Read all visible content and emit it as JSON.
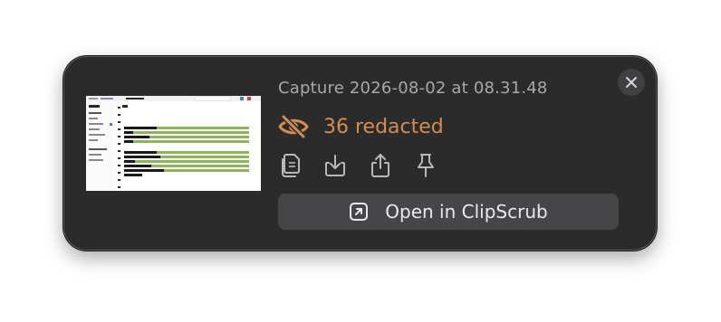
{
  "capture": {
    "title": "Capture 2026-08-02 at 08.31.48",
    "redacted_label": "36 redacted",
    "accent_color": "#d38d52"
  },
  "actions": [
    {
      "icon": "copy-icon",
      "label": "Copy"
    },
    {
      "icon": "save-icon",
      "label": "Save"
    },
    {
      "icon": "share-icon",
      "label": "Share"
    },
    {
      "icon": "pin-icon",
      "label": "Pin"
    }
  ],
  "open_button": {
    "label": "Open in ClipScrub",
    "icon": "open-external-icon"
  },
  "close": {
    "icon": "close-icon"
  },
  "thumbnail": {
    "alt": "screenshot-preview"
  }
}
